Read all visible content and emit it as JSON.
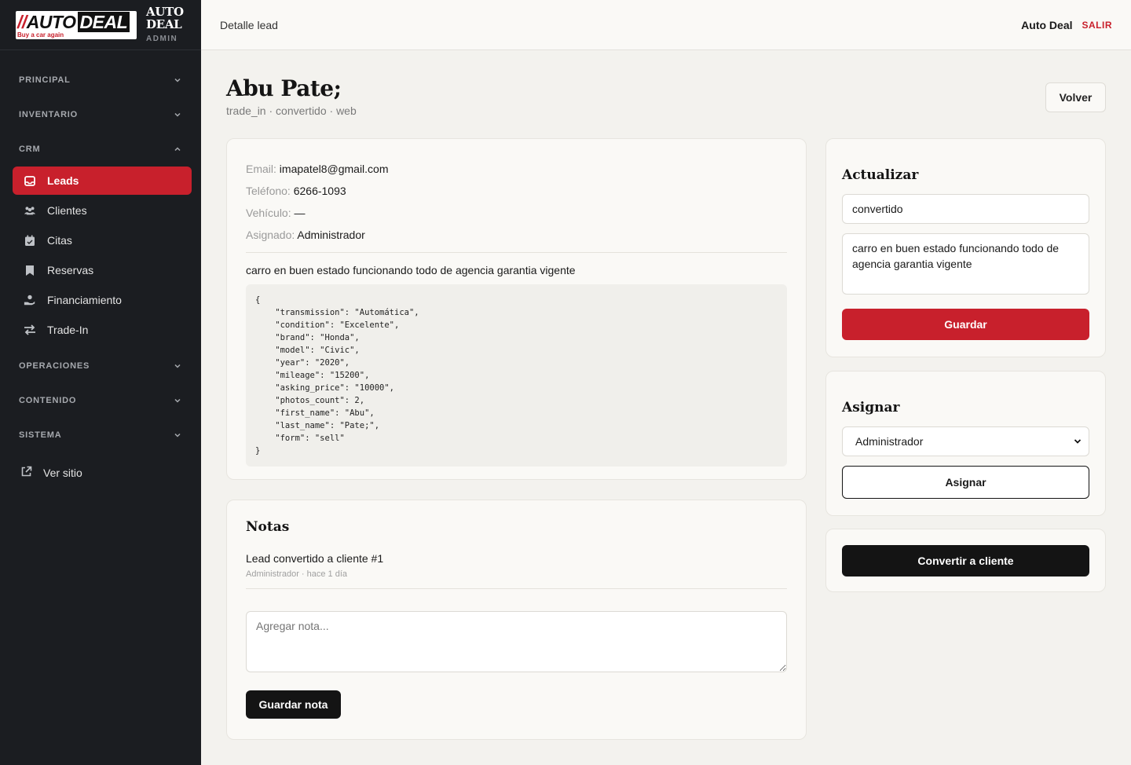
{
  "brand": {
    "logo_auto": "AUTO",
    "logo_deal": "DEAL",
    "logo_tagline": "Buy a car again",
    "name_line1": "AUTO",
    "name_line2": "DEAL",
    "name_line3": "ADMIN"
  },
  "sidebar": {
    "sections": {
      "principal": "PRINCIPAL",
      "inventario": "INVENTARIO",
      "crm": "CRM",
      "operaciones": "OPERACIONES",
      "contenido": "CONTENIDO",
      "sistema": "SISTEMA"
    },
    "crm_items": [
      "Leads",
      "Clientes",
      "Citas",
      "Reservas",
      "Financiamiento",
      "Trade-In"
    ],
    "ver_sitio": "Ver sitio"
  },
  "topbar": {
    "breadcrumb": "Detalle lead",
    "user": "Auto Deal",
    "logout": "SALIR"
  },
  "page": {
    "title": "Abu Pate;",
    "subtitle": "trade_in · convertido · web",
    "back_label": "Volver"
  },
  "lead": {
    "email_label": "Email:",
    "email": "imapatel8@gmail.com",
    "phone_label": "Teléfono:",
    "phone": "6266-1093",
    "vehicle_label": "Vehículo:",
    "vehicle": "—",
    "assigned_label": "Asignado:",
    "assigned": "Administrador",
    "description": "carro en buen estado funcionando todo de agencia garantia vigente",
    "json_payload": "{\n    \"transmission\": \"Automática\",\n    \"condition\": \"Excelente\",\n    \"brand\": \"Honda\",\n    \"model\": \"Civic\",\n    \"year\": \"2020\",\n    \"mileage\": \"15200\",\n    \"asking_price\": \"10000\",\n    \"photos_count\": 2,\n    \"first_name\": \"Abu\",\n    \"last_name\": \"Pate;\",\n    \"form\": \"sell\"\n}"
  },
  "notes": {
    "title": "Notas",
    "items": [
      {
        "text": "Lead convertido a cliente #1",
        "meta": "Administrador · hace 1 día"
      }
    ],
    "placeholder": "Agregar nota...",
    "save_label": "Guardar nota"
  },
  "update": {
    "title": "Actualizar",
    "status_value": "convertido",
    "notes_value": "carro en buen estado funcionando todo de agencia garantia vigente",
    "save_label": "Guardar"
  },
  "assign": {
    "title": "Asignar",
    "selected": "Administrador",
    "button_label": "Asignar"
  },
  "convert": {
    "button_label": "Convertir a cliente"
  },
  "colors": {
    "accent": "#c8202c",
    "sidebar_bg": "#1b1d21",
    "page_bg": "#f3f2ee"
  }
}
